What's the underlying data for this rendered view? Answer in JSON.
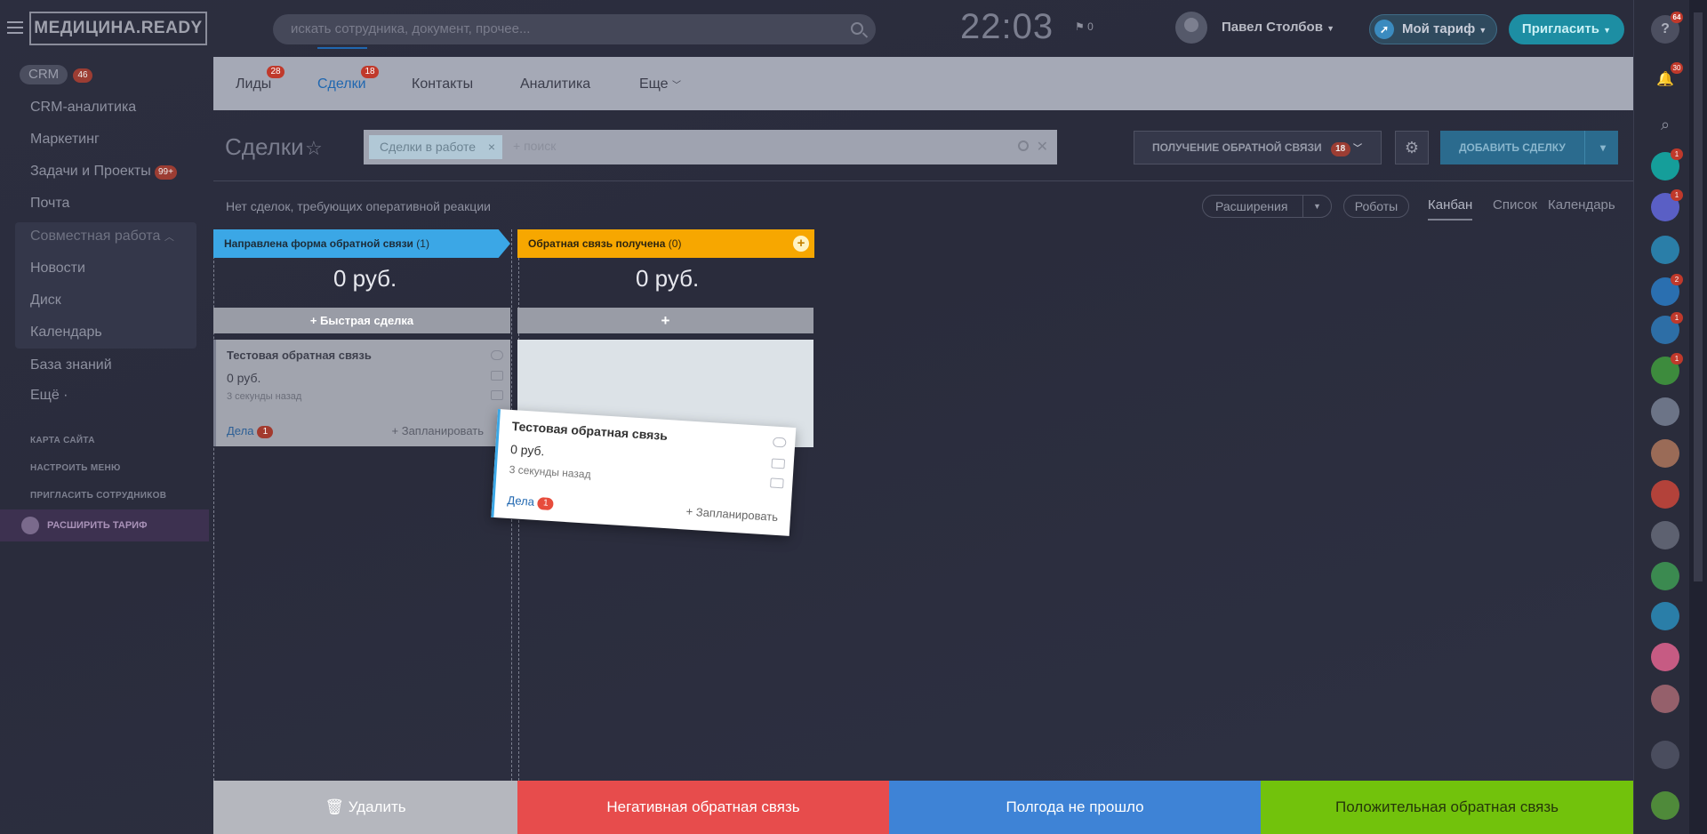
{
  "header": {
    "logo": "МЕДИЦИНА.READY",
    "search_placeholder": "искать сотрудника, документ, прочее...",
    "clock": "22:03",
    "flag_count": "0",
    "user_name": "Павел Столбов",
    "tariff_label": "Мой тариф",
    "invite_label": "Пригласить"
  },
  "sidebar": {
    "crm_label": "CRM",
    "crm_count": "46",
    "items": [
      "CRM-аналитика",
      "Маркетинг",
      "Задачи и Проекты",
      "Почта"
    ],
    "tasks_badge": "99+",
    "group_title": "Совместная работа",
    "group_items": [
      "Новости",
      "Диск",
      "Календарь"
    ],
    "knowledge": "База знаний",
    "more": "Ещё ·",
    "links": [
      "КАРТА САЙТА",
      "НАСТРОИТЬ МЕНЮ",
      "ПРИГЛАСИТЬ СОТРУДНИКОВ"
    ],
    "upgrade": "РАСШИРИТЬ ТАРИФ"
  },
  "tabs": [
    {
      "label": "Лиды",
      "badge": "28"
    },
    {
      "label": "Сделки",
      "badge": "18"
    },
    {
      "label": "Контакты"
    },
    {
      "label": "Аналитика"
    },
    {
      "label": "Еще"
    }
  ],
  "toolbar": {
    "page_title": "Сделки",
    "filter_chip": "Сделки в работе",
    "filter_search": "+ поиск",
    "funnel_label": "ПОЛУЧЕНИЕ ОБРАТНОЙ СВЯЗИ",
    "funnel_count": "18",
    "add_deal": "ДОБАВИТЬ СДЕЛКУ"
  },
  "subbar": {
    "no_deals": "Нет сделок, требующих оперативной реакции",
    "extensions": "Расширения",
    "robots": "Роботы",
    "views": [
      "Канбан",
      "Список",
      "Календарь"
    ]
  },
  "kanban": {
    "stages": [
      {
        "title": "Направлена форма обратной связи",
        "count": "(1)",
        "sum": "0 руб.",
        "color": "#3ba7e6"
      },
      {
        "title": "Обратная связь получена",
        "count": "(0)",
        "sum": "0 руб.",
        "color": "#f7a700"
      }
    ],
    "quick_deal": "Быстрая сделка",
    "card": {
      "title": "Тестовая обратная связь",
      "price": "0 руб.",
      "time": "3 секунды назад",
      "deals_label": "Дела",
      "deals_count": "1",
      "plan": "+ Запланировать"
    }
  },
  "bottom_actions": {
    "delete": "Удалить",
    "negative": "Негативная обратная связь",
    "half_year": "Полгода не прошло",
    "positive": "Положительная обратная связь"
  },
  "rightbar": {
    "help_badge": "64",
    "notif_badge": "30",
    "badges": [
      "1",
      "1",
      "2",
      "1",
      "1"
    ]
  }
}
